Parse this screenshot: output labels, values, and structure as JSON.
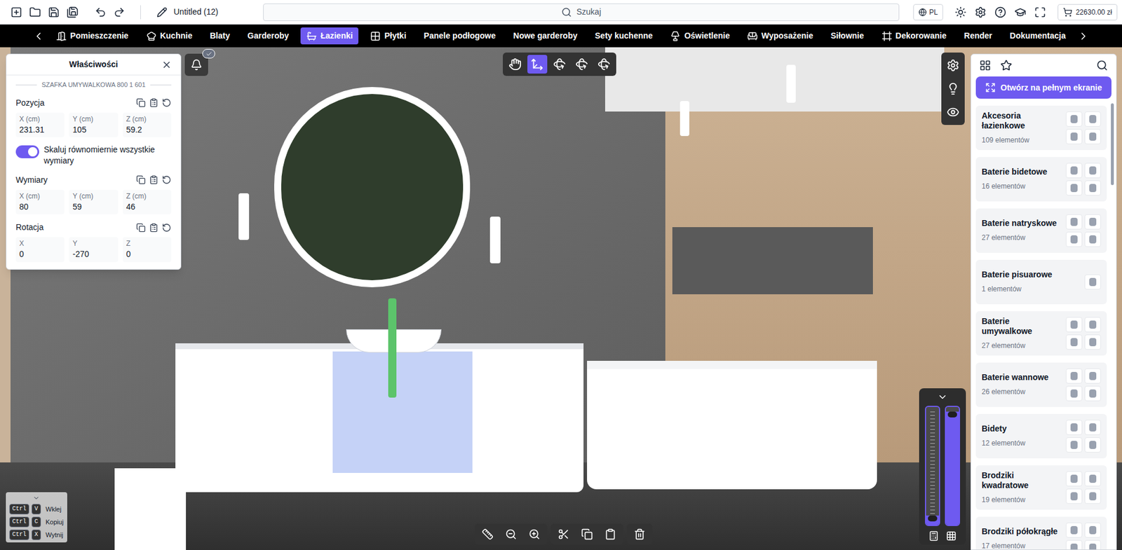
{
  "app": {
    "title": "Untitled (12)",
    "search_placeholder": "Szukaj",
    "language": "PL",
    "cart_total": "22630.00 zł"
  },
  "nav": {
    "items": [
      {
        "label": "Pomieszczenie",
        "selected": false
      },
      {
        "label": "Kuchnie",
        "selected": false
      },
      {
        "label": "Blaty",
        "selected": false
      },
      {
        "label": "Garderoby",
        "selected": false
      },
      {
        "label": "Łazienki",
        "selected": true
      },
      {
        "label": "Płytki",
        "selected": false
      },
      {
        "label": "Panele podłogowe",
        "selected": false
      },
      {
        "label": "Nowe garderoby",
        "selected": false
      },
      {
        "label": "Sety kuchenne",
        "selected": false
      },
      {
        "label": "Oświetlenie",
        "selected": false
      },
      {
        "label": "Wyposażenie",
        "selected": false
      },
      {
        "label": "Siłownie",
        "selected": false
      },
      {
        "label": "Dekorowanie",
        "selected": false
      },
      {
        "label": "Render",
        "selected": false
      },
      {
        "label": "Dokumentacja",
        "selected": false
      }
    ]
  },
  "properties": {
    "title": "Właściwości",
    "object_name": "SZAFKA UMYWALKOWA 800 1 601",
    "position": {
      "title": "Pozycja",
      "fields": [
        {
          "label": "X (cm)",
          "value": "231.31"
        },
        {
          "label": "Y (cm)",
          "value": "105"
        },
        {
          "label": "Z (cm)",
          "value": "59.2"
        }
      ]
    },
    "uniform_scale": {
      "label": "Skaluj równomiernie wszystkie wymiary",
      "on": true
    },
    "dimensions": {
      "title": "Wymiary",
      "fields": [
        {
          "label": "X (cm)",
          "value": "80"
        },
        {
          "label": "Y (cm)",
          "value": "59"
        },
        {
          "label": "Z (cm)",
          "value": "46"
        }
      ]
    },
    "rotation": {
      "title": "Rotacja",
      "fields": [
        {
          "label": "X",
          "value": "0"
        },
        {
          "label": "Y",
          "value": "-270"
        },
        {
          "label": "Z",
          "value": "0"
        }
      ]
    }
  },
  "notification": {
    "checked": true
  },
  "viewport_tools": [
    {
      "kind": "pan",
      "selected": false
    },
    {
      "kind": "move",
      "selected": true
    },
    {
      "kind": "rotate",
      "selected": false
    },
    {
      "kind": "rotate",
      "selected": false
    },
    {
      "kind": "rotate",
      "selected": false
    }
  ],
  "side_tools": [
    {
      "kind": "settings"
    },
    {
      "kind": "light"
    },
    {
      "kind": "visibility"
    }
  ],
  "catalog": {
    "open_fullscreen": "Otwórz na pełnym ekranie",
    "categories": [
      {
        "name": "Akcesoria łazienkowe",
        "count": "109 elementów",
        "thumbnails": 4
      },
      {
        "name": "Baterie bidetowe",
        "count": "16 elementów",
        "thumbnails": 4
      },
      {
        "name": "Baterie natryskowe",
        "count": "27 elementów",
        "thumbnails": 4
      },
      {
        "name": "Baterie pisuarowe",
        "count": "1 elementów",
        "thumbnails": 1
      },
      {
        "name": "Baterie umywalkowe",
        "count": "27 elementów",
        "thumbnails": 4
      },
      {
        "name": "Baterie wannowe",
        "count": "26 elementów",
        "thumbnails": 4
      },
      {
        "name": "Bidety",
        "count": "12 elementów",
        "thumbnails": 4
      },
      {
        "name": "Brodziki kwadratowe",
        "count": "19 elementów",
        "thumbnails": 4
      },
      {
        "name": "Brodziki półokrągłe",
        "count": "17 elementów",
        "thumbnails": 4
      }
    ]
  },
  "view_sliders": [
    {
      "level": 0.08
    },
    {
      "level": 0.96
    }
  ],
  "shortcuts": [
    {
      "keys": [
        "Ctrl",
        "V"
      ],
      "label": "Wklej"
    },
    {
      "keys": [
        "Ctrl",
        "C"
      ],
      "label": "Kopiuj"
    },
    {
      "keys": [
        "Ctrl",
        "X"
      ],
      "label": "Wytnij"
    }
  ]
}
